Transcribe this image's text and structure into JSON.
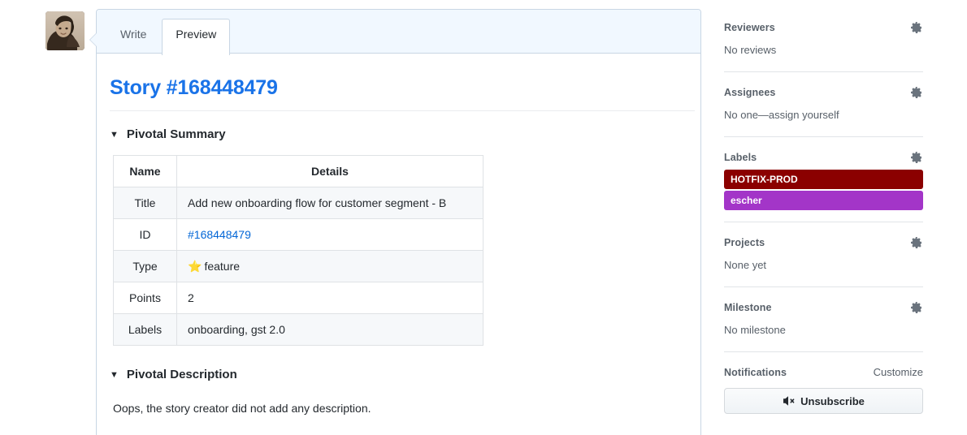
{
  "avatar": {
    "alt": "user-avatar"
  },
  "editor": {
    "tabs": [
      {
        "label": "Write",
        "active": false
      },
      {
        "label": "Preview",
        "active": true
      }
    ]
  },
  "preview": {
    "story_title": "Story #168448479",
    "summary_section": {
      "toggle_icon": "▼",
      "heading": "Pivotal Summary",
      "table": {
        "headers": [
          "Name",
          "Details"
        ],
        "rows": [
          {
            "name": "Title",
            "details": "Add new onboarding flow for customer segment - B",
            "kind": "text"
          },
          {
            "name": "ID",
            "details": "#168448479",
            "kind": "link"
          },
          {
            "name": "Type",
            "details": "feature",
            "kind": "emoji",
            "emoji": "⭐"
          },
          {
            "name": "Points",
            "details": "2",
            "kind": "text"
          },
          {
            "name": "Labels",
            "details": "onboarding, gst 2.0",
            "kind": "text"
          }
        ]
      }
    },
    "description_section": {
      "toggle_icon": "▼",
      "heading": "Pivotal Description",
      "body": "Oops, the story creator did not add any description."
    }
  },
  "sidebar": {
    "reviewers": {
      "title": "Reviewers",
      "value": "No reviews",
      "gear": "gear-icon"
    },
    "assignees": {
      "title": "Assignees",
      "value": "No one—assign yourself",
      "gear": "gear-icon"
    },
    "labels": {
      "title": "Labels",
      "gear": "gear-icon",
      "items": [
        {
          "name": "HOTFIX-PROD",
          "color": "#8b0000"
        },
        {
          "name": "escher",
          "color": "#a335c8"
        }
      ]
    },
    "projects": {
      "title": "Projects",
      "value": "None yet",
      "gear": "gear-icon"
    },
    "milestone": {
      "title": "Milestone",
      "value": "No milestone",
      "gear": "gear-icon"
    },
    "notifications": {
      "title": "Notifications",
      "customize_label": "Customize",
      "button_label": "Unsubscribe",
      "button_icon": "mute-speaker-icon"
    }
  },
  "colors": {
    "title_blue": "#1a73e8",
    "link_blue": "#0366d6",
    "tab_header_bg": "#f1f8ff",
    "muted_text": "#586069"
  }
}
